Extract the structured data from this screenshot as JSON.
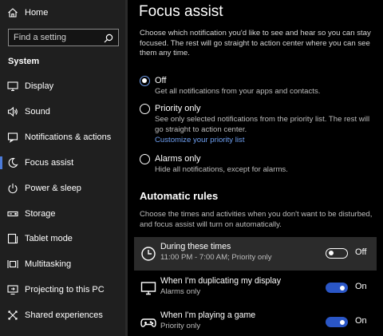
{
  "sidebar": {
    "home_label": "Home",
    "search_placeholder": "Find a setting",
    "section_title": "System",
    "items": [
      {
        "label": "Display",
        "icon": "display-icon"
      },
      {
        "label": "Sound",
        "icon": "sound-icon"
      },
      {
        "label": "Notifications & actions",
        "icon": "notifications-icon"
      },
      {
        "label": "Focus assist",
        "icon": "moon-icon"
      },
      {
        "label": "Power & sleep",
        "icon": "power-icon"
      },
      {
        "label": "Storage",
        "icon": "storage-icon"
      },
      {
        "label": "Tablet mode",
        "icon": "tablet-mode-icon"
      },
      {
        "label": "Multitasking",
        "icon": "multitasking-icon"
      },
      {
        "label": "Projecting to this PC",
        "icon": "projecting-icon"
      },
      {
        "label": "Shared experiences",
        "icon": "shared-experiences-icon"
      }
    ],
    "active_index": 3
  },
  "main": {
    "title": "Focus assist",
    "intro": "Choose which notification you'd like to see and hear so you can stay focused. The rest will go straight to action center where you can see them any time.",
    "options": [
      {
        "label": "Off",
        "desc": "Get all notifications from your apps and contacts.",
        "checked": true
      },
      {
        "label": "Priority only",
        "desc": "See only selected notifications from the priority list. The rest will go straight to action center.",
        "link": "Customize your priority list",
        "checked": false
      },
      {
        "label": "Alarms only",
        "desc": "Hide all notifications, except for alarms.",
        "checked": false
      }
    ],
    "automatic_rules": {
      "title": "Automatic rules",
      "desc": "Choose the times and activities when you don't want to be disturbed, and focus assist will turn on automatically.",
      "rules": [
        {
          "title": "During these times",
          "sub": "11:00 PM - 7:00 AM; Priority only",
          "state": "Off",
          "icon": "clock-icon"
        },
        {
          "title": "When I'm duplicating my display",
          "sub": "Alarms only",
          "state": "On",
          "icon": "monitor-icon"
        },
        {
          "title": "When I'm playing a game",
          "sub": "Priority only",
          "state": "On",
          "icon": "gamepad-icon"
        }
      ]
    }
  },
  "colors": {
    "accent": "#4c7bd9",
    "toggle_on": "#2a56c6",
    "link": "#6fa0f2",
    "sidebar_bg": "#1f1f1f",
    "main_bg": "#000000"
  }
}
